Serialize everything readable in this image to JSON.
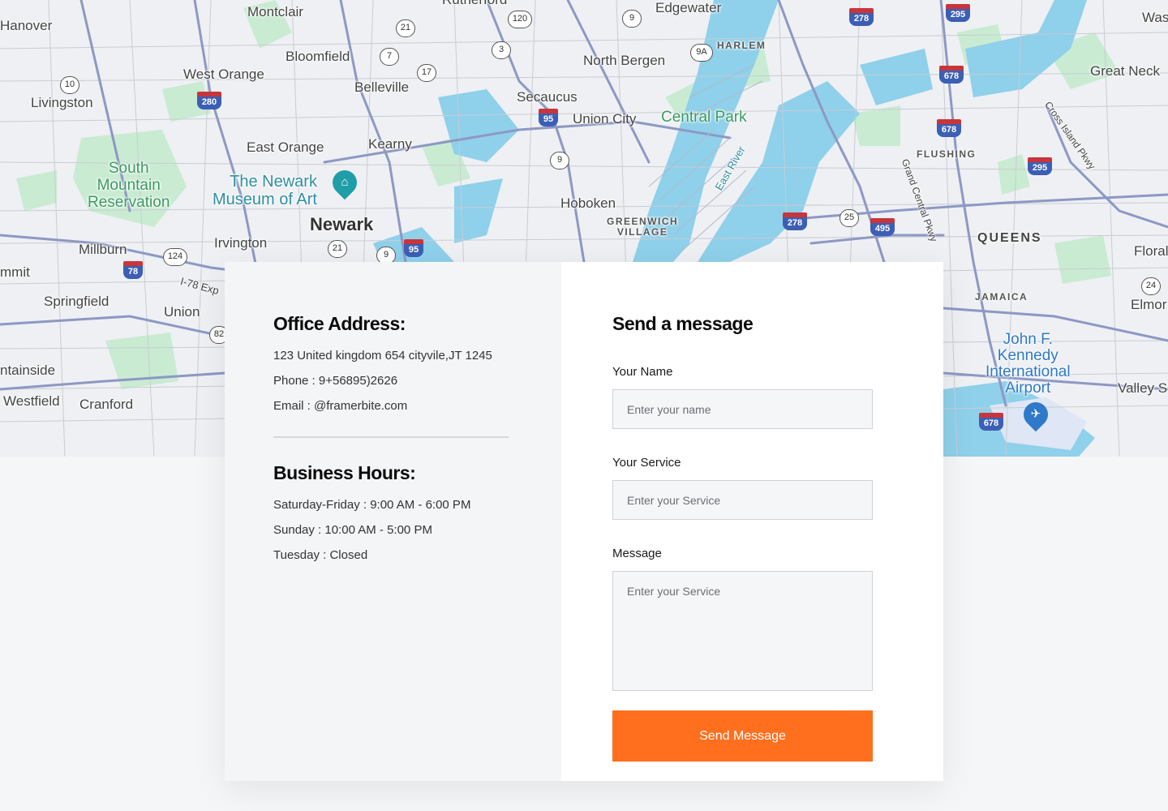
{
  "map": {
    "labels": {
      "montclair": "Montclair",
      "hanover": "Hanover",
      "bloomfield": "Bloomfield",
      "west_orange": "West Orange",
      "livingston": "Livingston",
      "belleville": "Belleville",
      "north_bergen": "North Bergen",
      "edgewater": "Edgewater",
      "harlem": "HARLEM",
      "rutherford": "Rutherford",
      "secaucus": "Secaucus",
      "union_city": "Union City",
      "central_park": "Central Park",
      "great_neck": "Great Neck",
      "east_orange": "East Orange",
      "kearny": "Kearny",
      "south_mountain": "South\nMountain\nReservation",
      "newark_museum": "The Newark\nMuseum of Art",
      "newark": "Newark",
      "hoboken": "Hoboken",
      "greenwich": "GREENWICH\nVILLAGE",
      "flushing": "FLUSHING",
      "queens": "QUEENS",
      "millburn": "Millburn",
      "irvington": "Irvington",
      "summit": "mmit",
      "springfield": "Springfield",
      "union": "Union",
      "jamaica": "JAMAICA",
      "jfk": "John F.\nKennedy\nInternational\nAirport",
      "plainfield": "ntainside",
      "westfield": "Westfield",
      "cranford": "Cranford",
      "valley": "Valley S",
      "floral": "Floral",
      "elmont": "Elmor",
      "wash": "Was",
      "east_river": "East River",
      "grand_central": "Grand Central Pkwy",
      "cross_island": "Cross Island Pkwy",
      "i78exp": "I-78 Exp"
    },
    "shields": [
      "10",
      "21",
      "7",
      "17",
      "3",
      "120",
      "9",
      "9A",
      "9",
      "21",
      "124",
      "25",
      "24",
      "82",
      "9"
    ],
    "interstates": [
      "280",
      "95",
      "278",
      "295",
      "678",
      "678",
      "295",
      "278",
      "495",
      "78",
      "95",
      "678"
    ]
  },
  "office": {
    "title": "Office Address:",
    "address": "123 United kingdom 654 cityvile,JT 1245",
    "phone": "Phone : 9+56895)2626",
    "email": "Email : @framerbite.com"
  },
  "hours": {
    "title": "Business Hours:",
    "line1": "Saturday-Friday : 9:00 AM - 6:00 PM",
    "line2": "Sunday : 10:00 AM - 5:00 PM",
    "line3": "Tuesday : Closed"
  },
  "form": {
    "title": "Send a message",
    "name_label": "Your Name",
    "name_placeholder": "Enter your name",
    "service_label": "Your Service",
    "service_placeholder": "Enter your Service",
    "message_label": "Message",
    "message_placeholder": "Enter your Service",
    "submit_label": "Send Message"
  },
  "colors": {
    "accent": "#ff6f1e",
    "water": "#8fd0ea",
    "park": "#c9ebd2",
    "road": "#8d98c4"
  }
}
